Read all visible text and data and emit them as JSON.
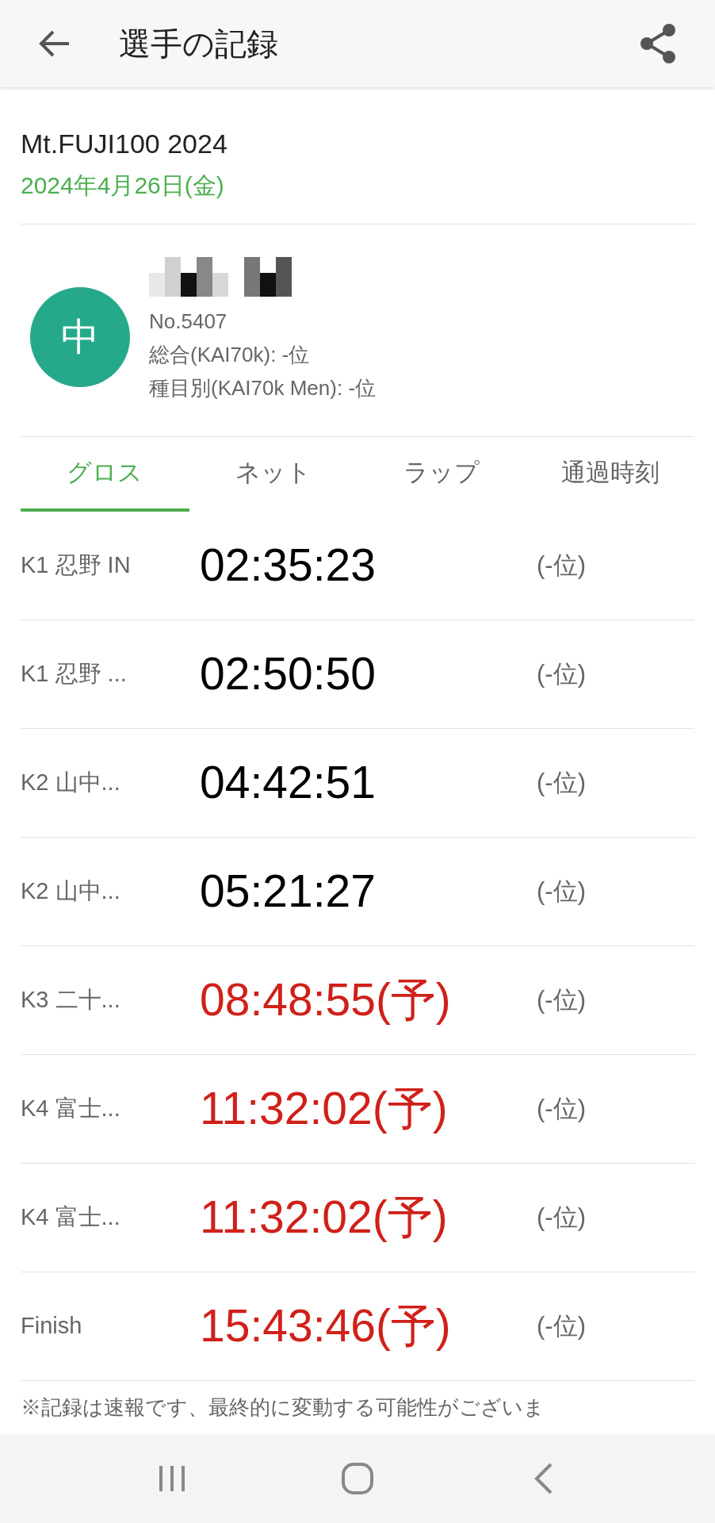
{
  "header": {
    "title": "選手の記録"
  },
  "event": {
    "name": "Mt.FUJI100 2024",
    "date": "2024年4月26日(金)"
  },
  "runner": {
    "avatar_char": "中",
    "number": "No.5407",
    "overall": "総合(KAI70k): -位",
    "category": "種目別(KAI70k Men): -位"
  },
  "tabs": [
    {
      "label": "グロス",
      "selected": true
    },
    {
      "label": "ネット",
      "selected": false
    },
    {
      "label": "ラップ",
      "selected": false
    },
    {
      "label": "通過時刻",
      "selected": false
    }
  ],
  "splits": [
    {
      "point": "K1 忍野 IN",
      "time": "02:35:23",
      "estimated": false,
      "rank": "(-位)"
    },
    {
      "point": "K1 忍野 ...",
      "time": "02:50:50",
      "estimated": false,
      "rank": "(-位)"
    },
    {
      "point": "K2 山中...",
      "time": "04:42:51",
      "estimated": false,
      "rank": "(-位)"
    },
    {
      "point": "K2 山中...",
      "time": "05:21:27",
      "estimated": false,
      "rank": "(-位)"
    },
    {
      "point": "K3 二十...",
      "time": "08:48:55(予)",
      "estimated": true,
      "rank": "(-位)"
    },
    {
      "point": "K4 富士...",
      "time": "11:32:02(予)",
      "estimated": true,
      "rank": "(-位)"
    },
    {
      "point": "K4 富士...",
      "time": "11:32:02(予)",
      "estimated": true,
      "rank": "(-位)"
    },
    {
      "point": "Finish",
      "time": "15:43:46(予)",
      "estimated": true,
      "rank": "(-位)"
    }
  ],
  "note": "※記録は速報です、最終的に変動する可能性がございま"
}
